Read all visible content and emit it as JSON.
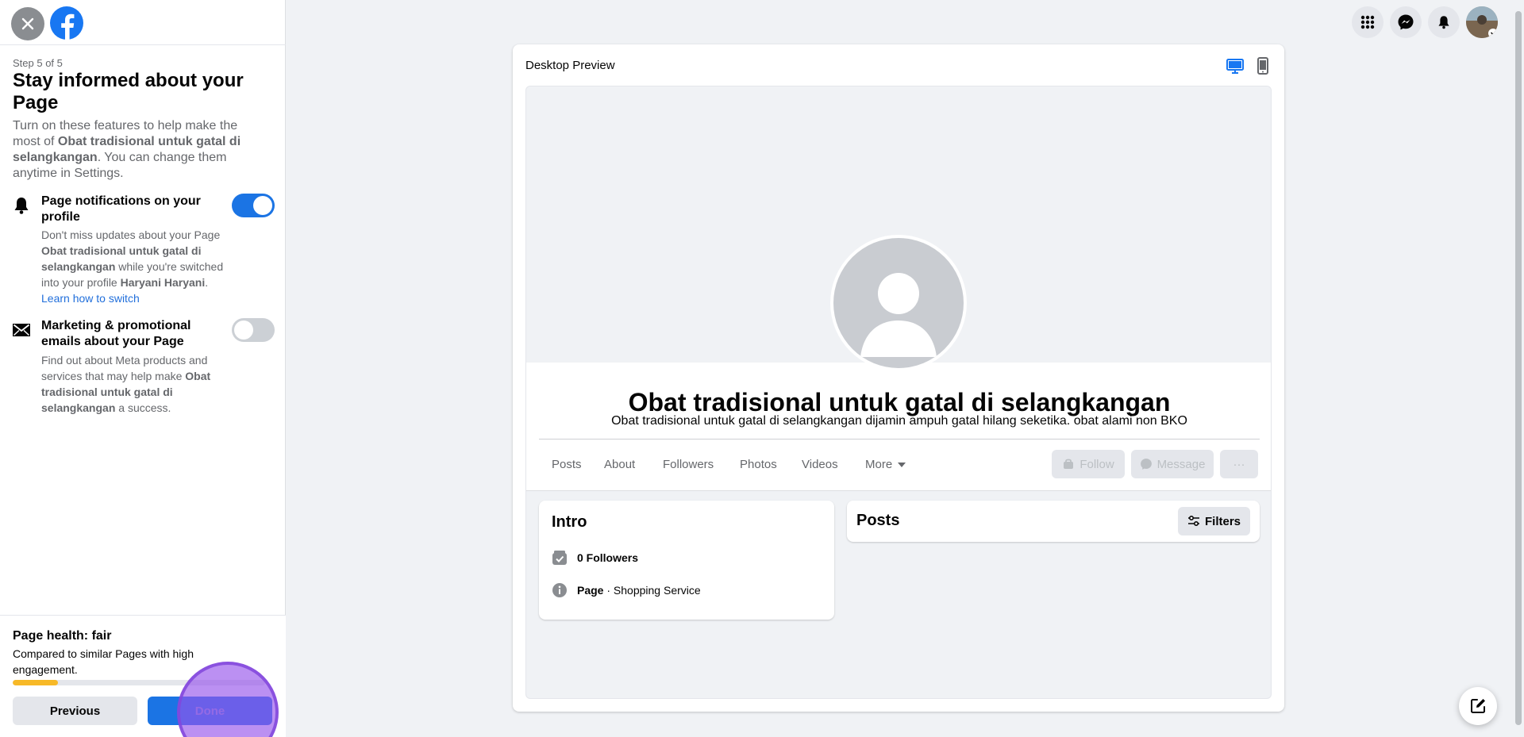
{
  "panel": {
    "step": "Step 5 of 5",
    "title": "Stay informed about your Page",
    "intro": {
      "before": "Turn on these features to help make the most of ",
      "page_name": "Obat tradisional untuk gatal di selangkangan",
      "after": ". You can change them anytime in Settings."
    },
    "features": [
      {
        "name": "Page notifications on your profile",
        "icon": "bell-icon",
        "enabled": true,
        "desc_a": "Don't miss updates about your Page ",
        "desc_b": "Obat tradisional untuk gatal di selangkangan",
        "desc_c": " while you're switched into your profile ",
        "desc_d": "Haryani Haryani",
        "desc_e": ". ",
        "link": "Learn how to switch"
      },
      {
        "name": "Marketing & promotional emails about your Page",
        "icon": "envelope-icon",
        "enabled": false,
        "desc_a": "Find out about Meta products and services that may help make ",
        "desc_b": "Obat tradisional untuk gatal di selangkangan",
        "desc_c": " a success."
      }
    ],
    "health": {
      "title": "Page health: fair",
      "desc": "Compared to similar Pages with high engagement.",
      "progress": 0.18,
      "color": "#f7b928"
    },
    "buttons": {
      "previous": "Previous",
      "done": "Done"
    }
  },
  "preview": {
    "label": "Desktop Preview",
    "active_device": "desktop",
    "page_name": "Obat tradisional untuk gatal di selangkangan",
    "page_description": "Obat tradisional untuk gatal di selangkangan dijamin ampuh gatal hilang seketika. obat alami non BKO",
    "tabs": [
      "Posts",
      "About",
      "Followers",
      "Photos",
      "Videos",
      "More"
    ],
    "actions": {
      "follow": "Follow",
      "message": "Message",
      "more": "···"
    },
    "intro": {
      "title": "Intro",
      "followers": "0 Followers",
      "category_label": "Page",
      "category_sep": " · ",
      "category": "Shopping Service"
    },
    "posts": {
      "title": "Posts",
      "filters": "Filters"
    }
  },
  "colors": {
    "brand": "#1877f2",
    "toggle_on": "#1b74e4"
  }
}
